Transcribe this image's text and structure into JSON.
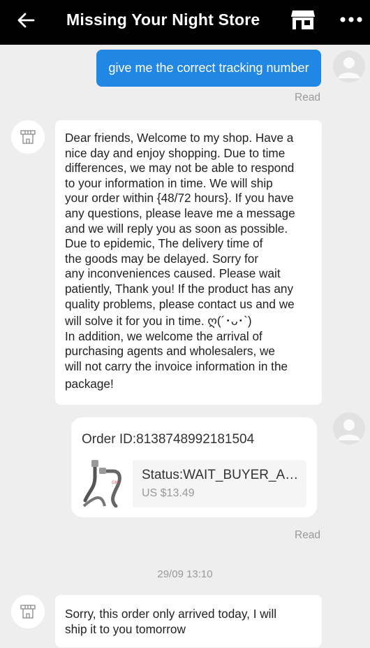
{
  "header": {
    "title": "Missing Your Night Store",
    "back_icon": "back-arrow-icon",
    "store_icon": "store-icon",
    "more_icon": "more-dots-icon"
  },
  "messages": {
    "outgoing_text": "give me the correct tracking number",
    "read_label_1": "Read",
    "welcome_lines": [
      "Dear friends, Welcome to my shop. Have a",
      "nice day and enjoy shopping. Due to time",
      "differences, we may not be able to respond",
      "to your information in time. We will ship",
      "your order within {48/72 hours}. If you have",
      "any questions, please leave me a message",
      "and we will reply you as soon as possible.",
      "Due to epidemic, The delivery time of",
      "the goods may be delayed. Sorry for",
      "any inconveniences caused. Please wait",
      "patiently, Thank you! If the product has any",
      "quality problems, please contact us and we",
      "will solve it for you in time. ღ(´･ᴗ･`)",
      "In addition, we welcome the arrival of",
      "purchasing agents and wholesalers, we",
      "will not carry the invoice information in the",
      "package!"
    ],
    "order": {
      "id_text": "Order ID:8138748992181504",
      "status_text": "Status:WAIT_BUYER_ACCEPT_GOODS",
      "price_text": "US $13.49"
    },
    "read_label_2": "Read",
    "timestamp": "29/09 13:10",
    "reply_lines": [
      "Sorry, this order only arrived today, I will",
      "ship it to you tomorrow"
    ]
  },
  "colors": {
    "header_bg": "#000000",
    "outgoing_bubble": "#2187e5",
    "page_bg": "#eeeeee"
  }
}
